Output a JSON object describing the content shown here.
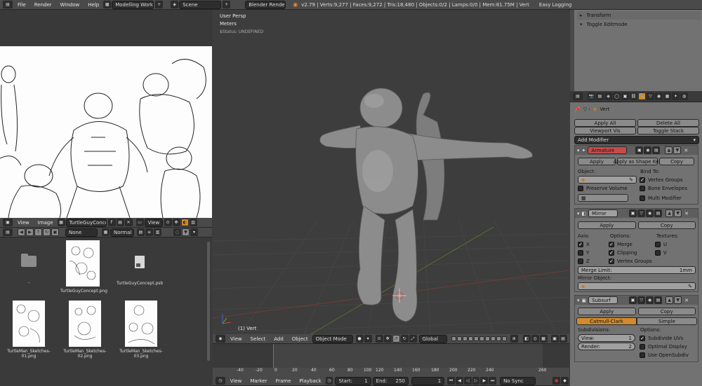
{
  "top_bar": {
    "menus": [
      "File",
      "Render",
      "Window",
      "Help"
    ],
    "workspace": "Modelling Workspace",
    "scene": "Scene",
    "engine": "Blender Render",
    "stats": "v2.79 | Verts:9,277 | Faces:9,272 | Tris:18,480 | Objects:0/2 | Lamps:0/0 | Mem:81.75M | Vert",
    "easy_logging": "Easy Logging"
  },
  "image_editor": {
    "menus": [
      "View",
      "Image"
    ],
    "image_name": "TurtleGuyConcept.p...",
    "f_label": "F",
    "view_label": "View"
  },
  "file_browser": {
    "none_label": "None",
    "normal_label": "Normal",
    "items": [
      {
        "name": "..",
        "kind": "folder"
      },
      {
        "name": "TurtleGuyConcept.png",
        "kind": "image"
      },
      {
        "name": "TurtleGuyConcept.psb",
        "kind": "file"
      },
      {
        "name": "TurtleMan_Sketches- 01.png",
        "kind": "image"
      },
      {
        "name": "TurtleMan_Sketches- 02.png",
        "kind": "image"
      },
      {
        "name": "TurtleMan_Sketches- 03.png",
        "kind": "image"
      }
    ]
  },
  "viewport": {
    "overlay_lines": [
      "User Persp",
      "Meters",
      "$Status: UNDEFINED"
    ],
    "object_label": "(1) Vert",
    "menus": [
      "View",
      "Select",
      "Add",
      "Object"
    ],
    "mode": "Object Mode",
    "orientation": "Global"
  },
  "timeline": {
    "ticks": [
      "-40",
      "-20",
      "0",
      "20",
      "40",
      "60",
      "80",
      "100",
      "120",
      "140",
      "160",
      "180",
      "200",
      "220",
      "240",
      "260"
    ],
    "current_frame": 0,
    "menus": [
      "View",
      "Marker",
      "Frame",
      "Playback"
    ],
    "start_label": "Start:",
    "start_value": "1",
    "end_label": "End:",
    "end_value": "250",
    "current_value": "1",
    "sync": "No Sync"
  },
  "tool_panel": {
    "transform": "Transform",
    "toggle_editmode": "Toggle Editmode"
  },
  "properties": {
    "object_name": "Vert",
    "apply_all": "Apply All",
    "delete_all": "Delete All",
    "viewport_vis": "Viewport Vis",
    "toggle_stack": "Toggle Stack",
    "add_modifier": "Add Modifier",
    "apply": "Apply",
    "apply_shape_key": "Apply as Shape Key",
    "copy": "Copy",
    "armature": {
      "name": "Armature",
      "object_label": "Object:",
      "bind_to": "Bind To:",
      "vertex_groups": "Vertex Groups",
      "bone_envelopes": "Bone Envelopes",
      "preserve_volume": "Preserve Volume",
      "multi_modifier": "Multi Modifier"
    },
    "mirror": {
      "name": "Mirror",
      "axis_label": "Axis:",
      "options_label": "Options:",
      "textures_label": "Textures:",
      "x": "X",
      "y": "Y",
      "z": "Z",
      "merge": "Merge",
      "clipping": "Clipping",
      "vertex_groups": "Vertex Groups",
      "u": "U",
      "v": "V",
      "merge_limit_label": "Merge Limit:",
      "merge_limit_value": "1mm",
      "mirror_object": "Mirror Object:"
    },
    "subsurf": {
      "name": "Subsurf",
      "catmull": "Catmull-Clark",
      "simple": "Simple",
      "subdivisions": "Subdivisions:",
      "options": "Options:",
      "view_label": "View:",
      "view_value": "1",
      "render_label": "Render:",
      "render_value": "2",
      "subdivide_uvs": "Subdivide UVs",
      "optimal_display": "Optimal Display",
      "use_opensubdiv": "Use OpenSubdiv"
    }
  }
}
